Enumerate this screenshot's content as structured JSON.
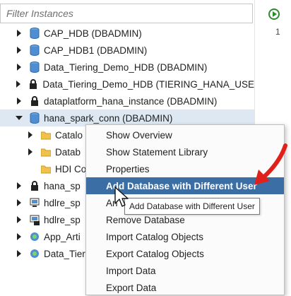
{
  "filter": {
    "placeholder": "Filter Instances"
  },
  "tree": [
    {
      "label": "CAP_HDB (DBADMIN)",
      "icon": "database-icon",
      "expanded": false
    },
    {
      "label": "CAP_HDB1 (DBADMIN)",
      "icon": "database-icon",
      "expanded": false
    },
    {
      "label": "Data_Tiering_Demo_HDB (DBADMIN)",
      "icon": "database-icon",
      "expanded": false
    },
    {
      "label": "Data_Tiering_Demo_HDB (TIERING_HANA_USE",
      "icon": "locked-database-icon",
      "expanded": false
    },
    {
      "label": "dataplatform_hana_instance (DBADMIN)",
      "icon": "locked-database-icon",
      "expanded": false
    },
    {
      "label": "hana_spark_conn (DBADMIN)",
      "icon": "database-icon",
      "expanded": true
    },
    {
      "label": "Catalo",
      "icon": "folder-icon",
      "expanded": false
    },
    {
      "label": "Datab",
      "icon": "folder-icon",
      "expanded": false
    },
    {
      "label": "HDI Co",
      "icon": "folder-icon",
      "expanded": null
    },
    {
      "label": "hana_sp",
      "icon": "locked-database-icon",
      "expanded": false
    },
    {
      "label": "hdlre_sp",
      "icon": "server-icon",
      "expanded": false
    },
    {
      "label": "hdlre_sp",
      "icon": "locked-server-icon",
      "expanded": false
    },
    {
      "label": "App_Arti",
      "icon": "app-icon",
      "expanded": false
    },
    {
      "label": "Data_Tier",
      "icon": "app-icon",
      "expanded": false
    }
  ],
  "editor": {
    "line_number": "1"
  },
  "context_menu": {
    "items": [
      "Show Overview",
      "Show Statement Library",
      "Properties",
      "Add Database with Different User",
      "An",
      "Remove Database",
      "Import Catalog Objects",
      "Export Catalog Objects",
      "Import Data",
      "Export Data"
    ],
    "highlighted": "Add Database with Different User"
  },
  "tooltip": {
    "text": "Add Database with Different User"
  },
  "colors": {
    "highlight": "#3b6ea5",
    "annotation_arrow": "#e0201b",
    "folder": "#f0c24b",
    "database": "#4f8fd1"
  }
}
